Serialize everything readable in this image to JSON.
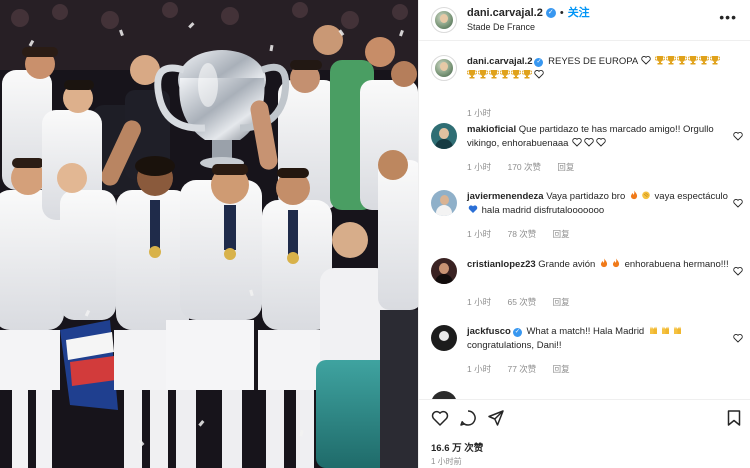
{
  "post": {
    "username": "dani.carvajal.2",
    "follow_label": "关注",
    "location": "Stade De France",
    "more_label": "•••"
  },
  "caption": {
    "username": "dani.carvajal.2",
    "text": "REYES DE EUROPA",
    "time": "1 小时"
  },
  "comments": [
    {
      "username": "makioficial",
      "text": "Que partidazo te has marcado amigo!! Orgullo vikingo, enhorabuenaaa",
      "time": "1 小时",
      "likes": "170 次赞",
      "reply": "回复",
      "avatar_color": "#2f6e74"
    },
    {
      "username": "javiermenendeza",
      "text_before": "Vaya partidazo bro",
      "text_after": "vaya espectáculo",
      "text_end": "hala madrid disfrutalooooooo",
      "time": "1 小时",
      "likes": "78 次赞",
      "reply": "回复",
      "avatar_color": "#8fb0c9"
    },
    {
      "username": "cristianlopez23",
      "text_before": "Grande avión",
      "text_after": "enhorabuena hermano!!!",
      "time": "1 小时",
      "likes": "65 次赞",
      "reply": "回复",
      "avatar_color": "#3a2222"
    },
    {
      "username": "jackfusco",
      "text_before": "What a match!! Hala Madrid",
      "text_after": "congratulations, Dani!!",
      "time": "1 小时",
      "likes": "77 次赞",
      "reply": "回复",
      "avatar_color": "#1c1c1c"
    }
  ],
  "footer": {
    "likes": "16.6 万 次赞",
    "time": "1 小时前"
  },
  "icons": {
    "heart": "heart-icon",
    "comment": "comment-icon",
    "share": "share-icon",
    "save": "bookmark-icon"
  },
  "colors": {
    "accent": "#0095f6",
    "verified": "#3897f0",
    "muted": "#8e8e8e"
  }
}
